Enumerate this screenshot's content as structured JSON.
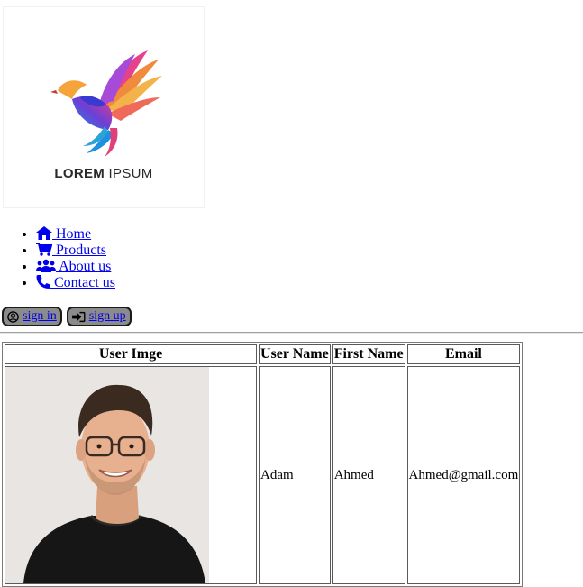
{
  "logo": {
    "brand_bold": "LOREM",
    "brand_light": " IPSUM"
  },
  "nav": [
    {
      "icon": "home-icon",
      "label": " Home"
    },
    {
      "icon": "cart-icon",
      "label": " Products"
    },
    {
      "icon": "users-icon",
      "label": " About us"
    },
    {
      "icon": "phone-icon",
      "label": " Contact us"
    }
  ],
  "auth": {
    "signin_label": "sign in",
    "signup_label": "sign up"
  },
  "table": {
    "headers": [
      "User Imge",
      "User Name",
      "First Name",
      "Email"
    ],
    "rows": [
      {
        "username": "Adam",
        "firstname": "Ahmed",
        "email": "Ahmed@gmail.com"
      }
    ]
  },
  "colors": {
    "link": "#0000ee",
    "button_bg": "#8b8b8b"
  }
}
